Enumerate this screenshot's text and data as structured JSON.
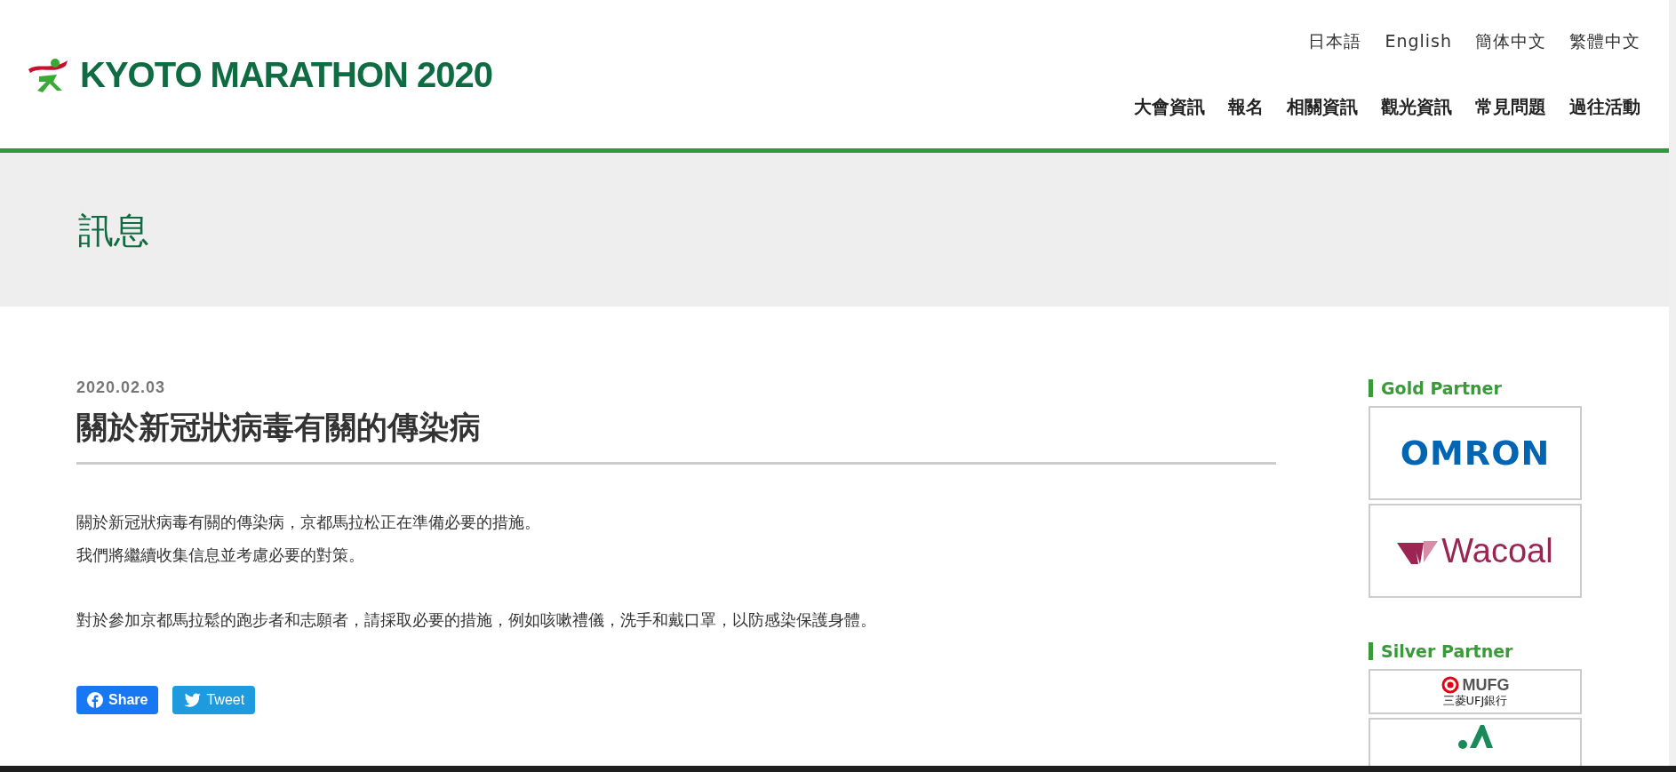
{
  "logo": {
    "text": "KYOTO MARATHON 2020"
  },
  "languages": [
    {
      "label": "日本語"
    },
    {
      "label": "English"
    },
    {
      "label": "簡体中文"
    },
    {
      "label": "繁體中文"
    }
  ],
  "nav": [
    {
      "label": "大會資訊"
    },
    {
      "label": "報名"
    },
    {
      "label": "相關資訊"
    },
    {
      "label": "觀光資訊"
    },
    {
      "label": "常見問題"
    },
    {
      "label": "過往活動"
    }
  ],
  "page_title": "訊息",
  "article": {
    "date": "2020.02.03",
    "title": "關於新冠狀病毒有關的傳染病",
    "paragraphs": [
      [
        "關於新冠狀病毒有關的傳染病，京都馬拉松正在準備必要的措施。",
        "我們將繼續收集信息並考慮必要的對策。"
      ],
      [
        "對於參加京都馬拉鬆的跑步者和志願者，請採取必要的措施，例如咳嗽禮儀，洗手和戴口罩，以防感染保護身體。"
      ]
    ]
  },
  "share_buttons": [
    {
      "kind": "facebook",
      "label": "Share"
    },
    {
      "kind": "twitter",
      "label": "Tweet"
    }
  ],
  "sidebar": [
    {
      "heading": "Gold Partner",
      "partners": [
        {
          "kind": "omron",
          "name": "OMRON"
        },
        {
          "kind": "wacoal",
          "name": "Wacoal"
        }
      ]
    },
    {
      "heading": "Silver Partner",
      "partners": [
        {
          "kind": "mufg",
          "name": "MUFG",
          "subname": "三菱UFJ銀行"
        },
        {
          "kind": "ja"
        }
      ]
    }
  ]
}
